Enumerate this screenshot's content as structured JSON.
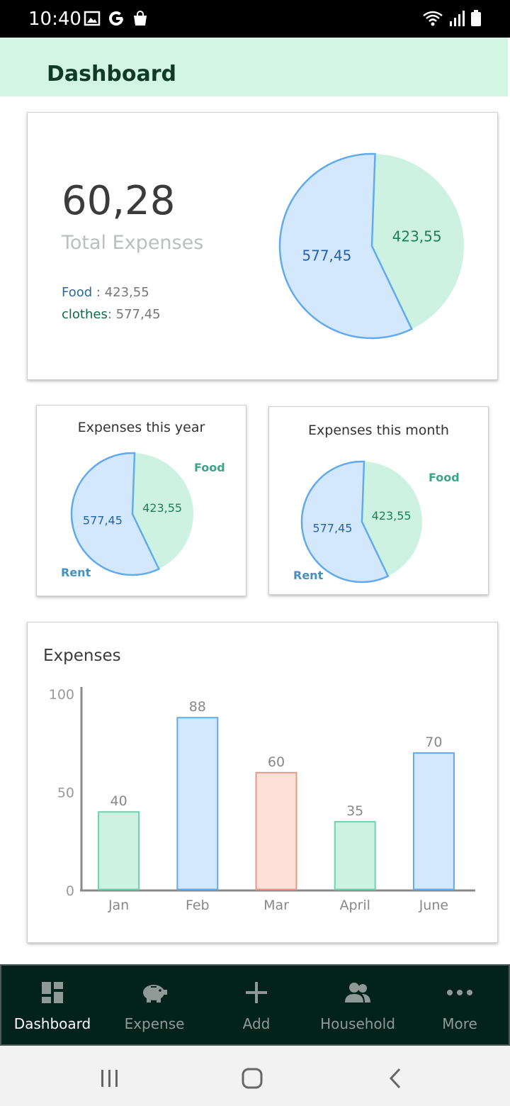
{
  "status_bar": {
    "time": "10:40"
  },
  "app_bar": {
    "title": "Dashboard"
  },
  "summary": {
    "total_value": "60,28",
    "total_label": "Total Expenses",
    "legend": [
      {
        "key": "Food",
        "value": "423,55"
      },
      {
        "key": "clothes",
        "value": "577,45"
      }
    ]
  },
  "colors": {
    "green_fill": "#cdf2e2",
    "blue_fill": "#d3e8fc",
    "blue_stroke": "#62aaee",
    "salmon_fill": "#fde0d7",
    "salmon_stroke": "#e89a88",
    "green_stroke": "#6ed3aa",
    "nav_bg": "#03231a",
    "appbar_bg": "#d3f5e4"
  },
  "chart_data": [
    {
      "type": "pie",
      "labels": [
        "Food",
        "clothes"
      ],
      "values": [
        423.55,
        577.45
      ],
      "value_labels": [
        "423,55",
        "577,45"
      ]
    },
    {
      "type": "pie",
      "title": "Expenses this year",
      "labels": [
        "Food",
        "Rent"
      ],
      "values": [
        423.55,
        577.45
      ],
      "value_labels": [
        "423,55",
        "577,45"
      ]
    },
    {
      "type": "pie",
      "title": "Expenses this month",
      "labels": [
        "Food",
        "Rent"
      ],
      "values": [
        423.55,
        577.45
      ],
      "value_labels": [
        "423,55",
        "577,45"
      ]
    },
    {
      "type": "bar",
      "title": "Expenses",
      "categories": [
        "Jan",
        "Feb",
        "Mar",
        "April",
        "June"
      ],
      "values": [
        40,
        88,
        60,
        35,
        70
      ],
      "bar_colors": [
        "green",
        "blue",
        "salmon",
        "green",
        "blue"
      ],
      "ylim": [
        0,
        100
      ],
      "yticks": [
        0,
        50,
        100
      ]
    }
  ],
  "bottom_nav": [
    {
      "label": "Dashboard",
      "icon": "dashboard-icon",
      "active": true
    },
    {
      "label": "Expense",
      "icon": "piggy-bank-icon",
      "active": false
    },
    {
      "label": "Add",
      "icon": "plus-icon",
      "active": false
    },
    {
      "label": "Household",
      "icon": "people-icon",
      "active": false
    },
    {
      "label": "More",
      "icon": "more-dots-icon",
      "active": false
    }
  ]
}
